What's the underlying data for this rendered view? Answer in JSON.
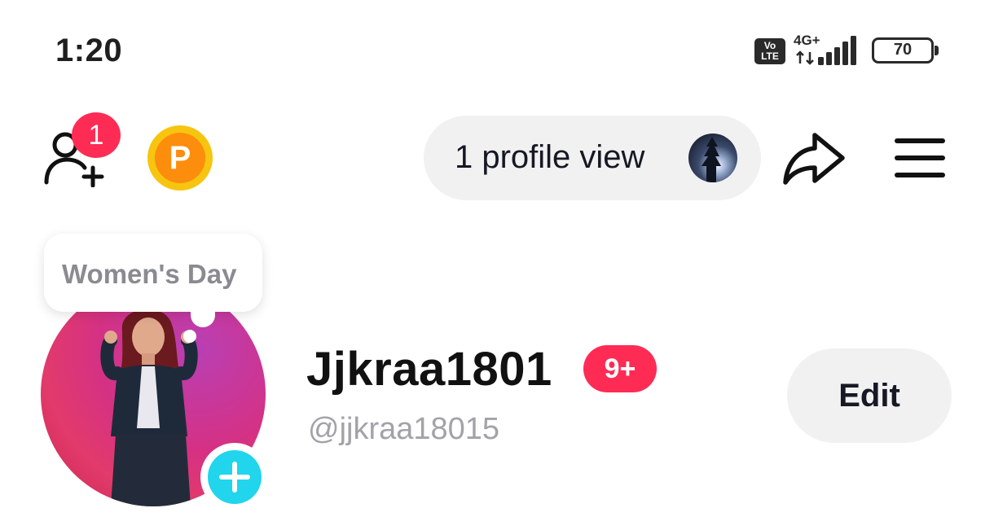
{
  "status_bar": {
    "time": "1:20",
    "volte_top": "Vo",
    "volte_bottom": "LTE",
    "network": "4G+",
    "battery": "70",
    "battery_level": 0.7,
    "icons": [
      "volte-icon",
      "network-arrows-icon",
      "signal-icon",
      "battery-icon"
    ]
  },
  "header": {
    "friend_requests_count": "1",
    "coin_label": "P",
    "profile_views": "1 profile view",
    "icons": [
      "add-friend-icon",
      "coin-icon",
      "share-icon",
      "menu-icon"
    ]
  },
  "profile": {
    "bubble_text": "Women's Day",
    "username": "Jjkraa1801",
    "badge": "9+",
    "handle": "@jjkraa18015",
    "edit_label": "Edit"
  },
  "colors": {
    "accent": "#fe2c55",
    "add_avatar": "#20d5ec",
    "coin": "#f7c50f",
    "pill_bg": "#f1f1f2"
  }
}
